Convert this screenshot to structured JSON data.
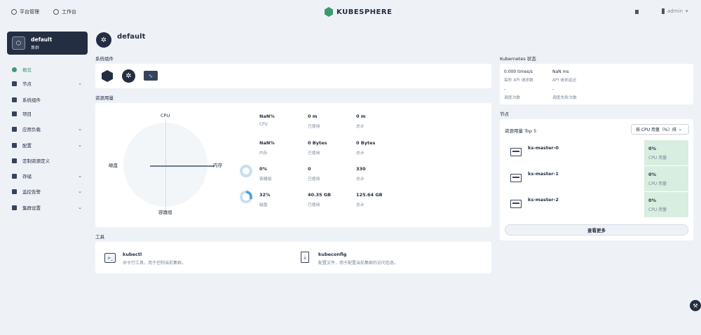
{
  "topbar": {
    "platform_label": "平台管理",
    "workbench_label": "工作台",
    "brand": "KUBESPHERE",
    "user": "admin"
  },
  "cluster": {
    "name": "default",
    "type": "集群"
  },
  "sidebar": {
    "items": [
      {
        "label": "概览",
        "chevron": false
      },
      {
        "label": "节点",
        "chevron": true
      },
      {
        "label": "系统组件",
        "chevron": false
      },
      {
        "label": "项目",
        "chevron": false
      },
      {
        "label": "应用负载",
        "chevron": true
      },
      {
        "label": "配置",
        "chevron": true
      },
      {
        "label": "定制资源定义",
        "chevron": false
      },
      {
        "label": "存储",
        "chevron": true
      },
      {
        "label": "监控告警",
        "chevron": true
      },
      {
        "label": "集群设置",
        "chevron": true
      }
    ]
  },
  "page_title": "default",
  "system_components": {
    "title": "系统组件"
  },
  "resource_usage": {
    "title": "资源用量",
    "radar": {
      "top": "CPU",
      "right": "内存",
      "bottom": "容器组",
      "left": "磁盘"
    },
    "rows": [
      {
        "pct": "NaN%",
        "pct_label": "CPU",
        "used": "0 m",
        "used_label": "已使用",
        "total": "0 m",
        "total_label": "总计",
        "donut": false
      },
      {
        "pct": "NaN%",
        "pct_label": "内存",
        "used": "0 Bytes",
        "used_label": "已使用",
        "total": "0 Bytes",
        "total_label": "总计",
        "donut": false
      },
      {
        "pct": "0%",
        "pct_label": "容器组",
        "used": "0",
        "used_label": "已使用",
        "total": "330",
        "total_label": "总计",
        "donut": true,
        "fill": 0
      },
      {
        "pct": "32%",
        "pct_label": "磁盘",
        "used": "40.35 GB",
        "used_label": "已使用",
        "total": "125.64 GB",
        "total_label": "总计",
        "donut": true,
        "fill": 0.32
      }
    ]
  },
  "tools": {
    "title": "工具",
    "items": [
      {
        "name": "kubectl",
        "desc": "命令行工具，用于控制当前集群。"
      },
      {
        "name": "kubeconfig",
        "desc": "配置文件，用于配置当前集群的访问信息。"
      }
    ]
  },
  "k8s_status": {
    "title": "Kubernetes 状态",
    "metrics": [
      {
        "value": "0.000 times/s",
        "label": "每秒 API 请求数"
      },
      {
        "value": "NaN ms",
        "label": "API 请求延迟"
      },
      {
        "value": "-",
        "label": "调度次数"
      },
      {
        "value": "-",
        "label": "调度失败次数"
      }
    ]
  },
  "nodes": {
    "title": "节点",
    "top_label": "资源用量 Top 5",
    "sort_label": "按 CPU 用量（%）排",
    "items": [
      {
        "name": "ks-master-0",
        "cpu": "0%",
        "cpu_label": "CPU 用量"
      },
      {
        "name": "ks-master-1",
        "cpu": "0%",
        "cpu_label": "CPU 用量"
      },
      {
        "name": "ks-master-2",
        "cpu": "0%",
        "cpu_label": "CPU 用量"
      }
    ],
    "more_label": "查看更多"
  },
  "colors": {
    "accent": "#3a9b6f",
    "dark": "#242e42",
    "donut": "#4a9fd6"
  }
}
